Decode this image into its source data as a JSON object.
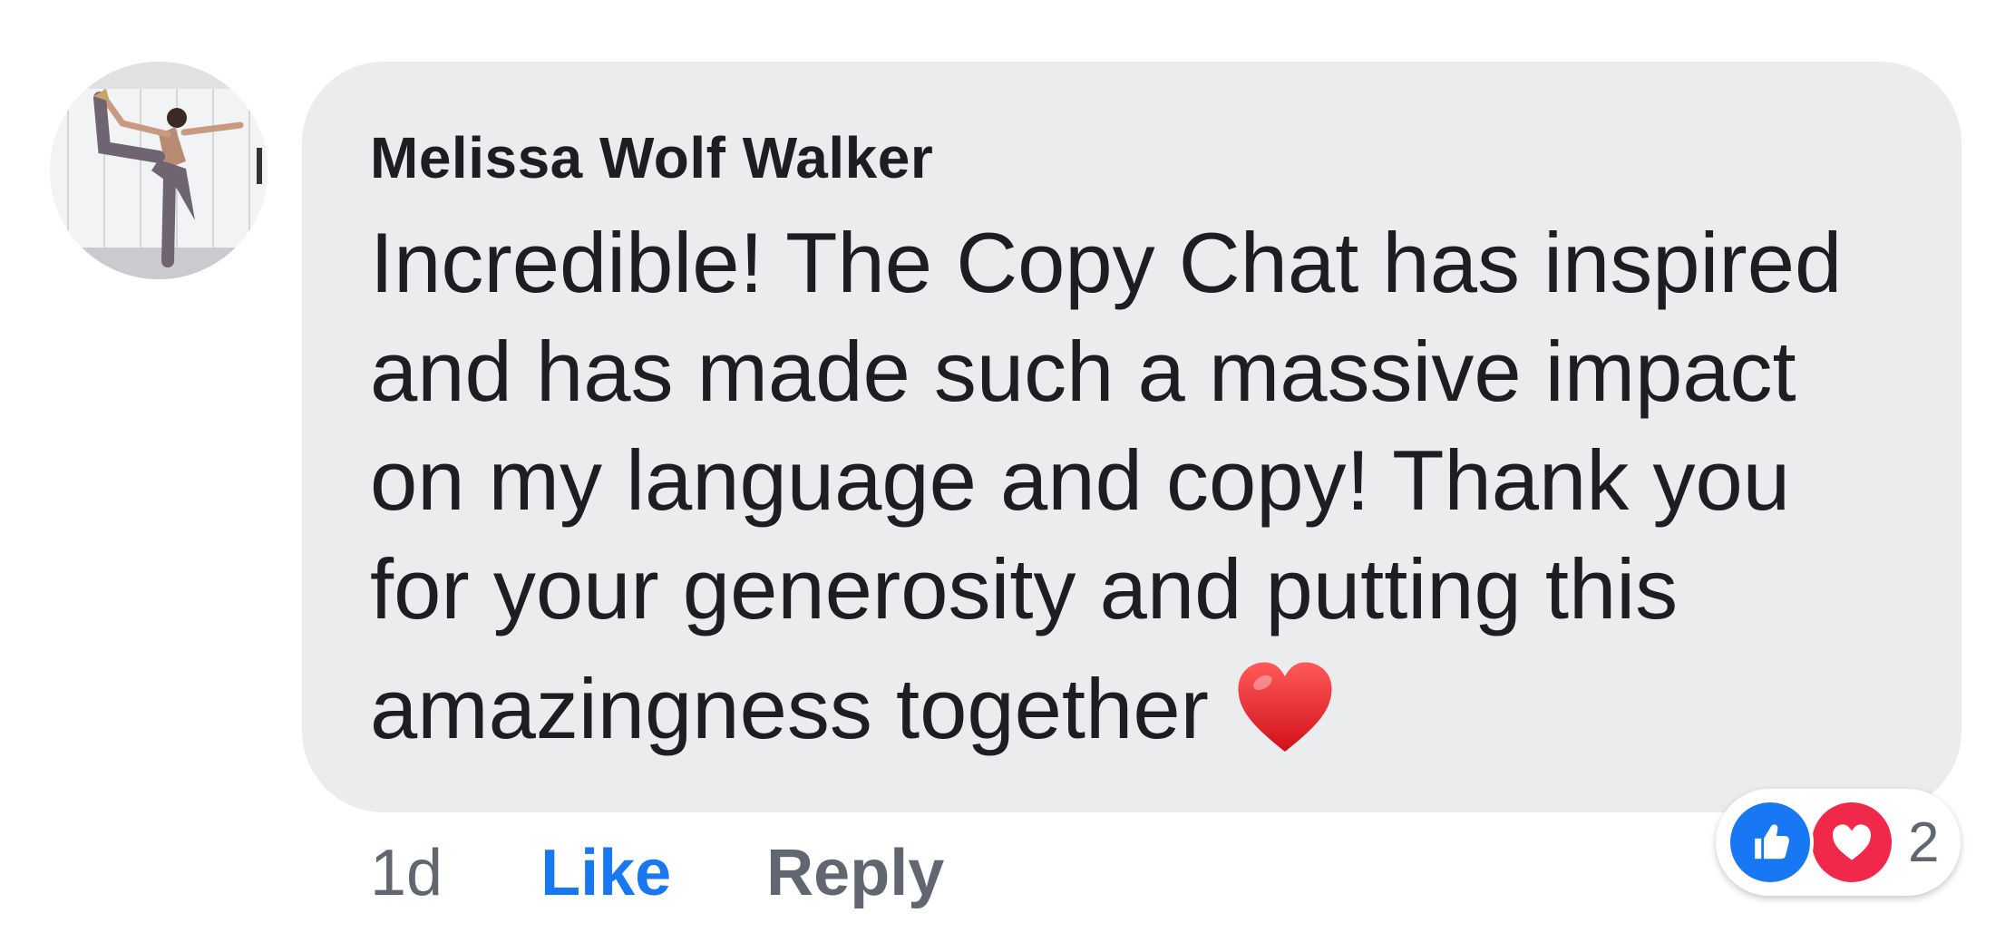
{
  "comment": {
    "author": "Melissa Wolf Walker",
    "text_lines": [
      "Incredible! The Copy Chat has inspired",
      "and has made such a massive impact",
      "on my language and copy! Thank you",
      "for your generosity and putting this",
      "amazingness together"
    ],
    "emoji": "heart-emoji"
  },
  "actions": {
    "time": "1d",
    "like_label": "Like",
    "reply_label": "Reply"
  },
  "reactions": {
    "types": [
      "like",
      "love"
    ],
    "count": "2"
  },
  "colors": {
    "bubble_bg": "#ebecee",
    "like_blue": "#1877f2",
    "love_red": "#f0284a",
    "muted_text": "#606770",
    "main_text": "#1c1e21"
  }
}
